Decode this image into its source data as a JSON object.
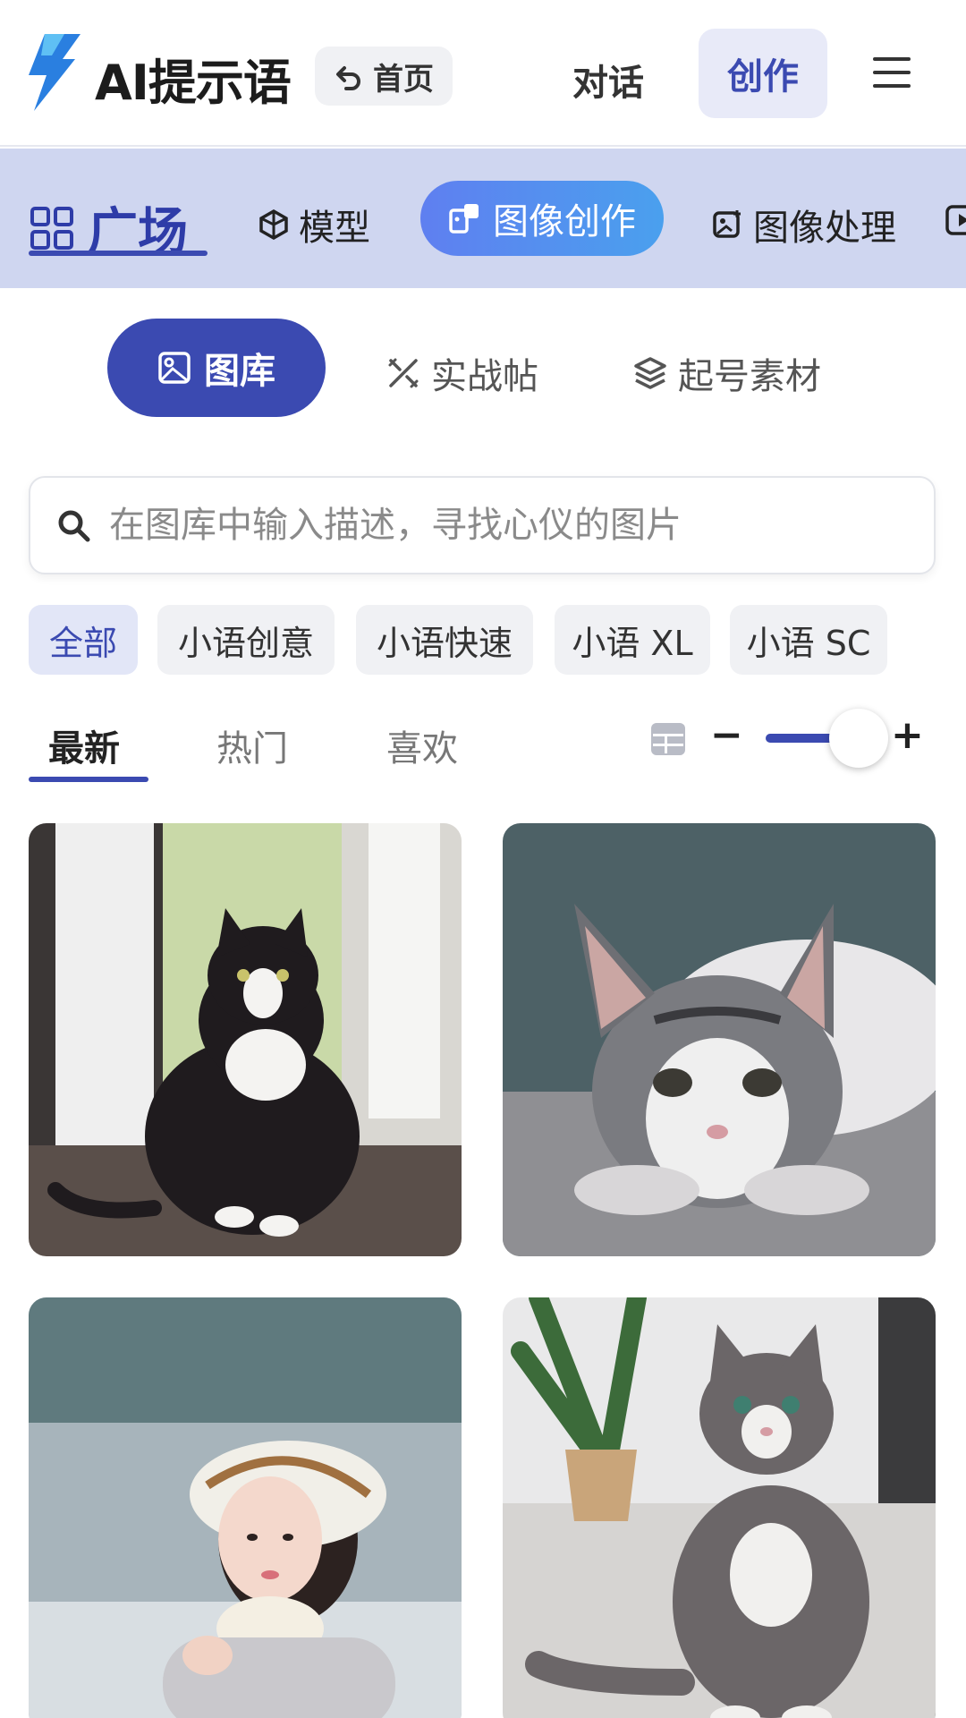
{
  "header": {
    "brand": "AI提示语",
    "home_label": "首页",
    "nav": {
      "chat": "对话",
      "create": "创作"
    }
  },
  "categories": {
    "square": "广场",
    "items": [
      {
        "label": "模型",
        "icon": "model-icon"
      },
      {
        "label": "图像创作",
        "icon": "image-create-icon",
        "active": true
      },
      {
        "label": "图像处理",
        "icon": "image-edit-icon"
      }
    ]
  },
  "subtabs": [
    {
      "label": "图库",
      "icon": "image-icon",
      "active": true
    },
    {
      "label": "实战帖",
      "icon": "tools-icon"
    },
    {
      "label": "起号素材",
      "icon": "layers-icon"
    }
  ],
  "search": {
    "placeholder": "在图库中输入描述，寻找心仪的图片"
  },
  "filters": [
    "全部",
    "小语创意",
    "小语快速",
    "小语 XL",
    "小语 SC"
  ],
  "sort_tabs": [
    "最新",
    "热门",
    "喜欢"
  ],
  "zoom": {
    "minus": "−",
    "plus": "+",
    "level": 0.8
  },
  "gallery": [
    {
      "subject": "black and white cat sitting by open door"
    },
    {
      "subject": "tabby cat lying on floor"
    },
    {
      "subject": "girl in white beret in snow"
    },
    {
      "subject": "tabby cat sitting by potted plant"
    }
  ],
  "colors": {
    "accent": "#3b4ab1",
    "category_bar": "#cfd6f0",
    "active_pill_start": "#5f7ff0",
    "active_pill_end": "#4aa0ee"
  }
}
